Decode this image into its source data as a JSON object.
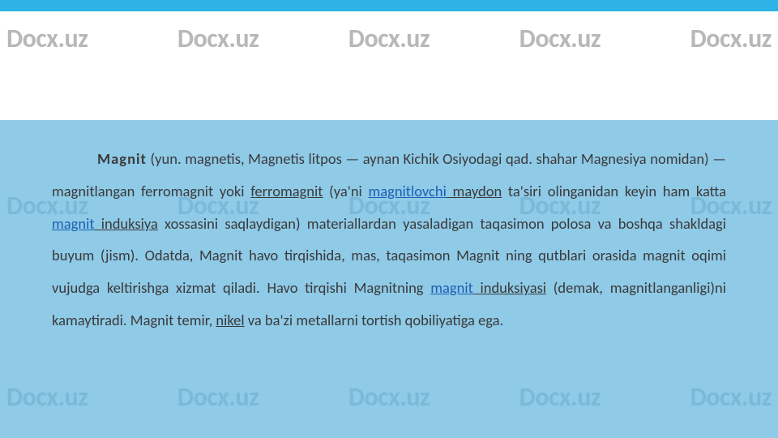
{
  "watermark": "Docx.uz",
  "body": {
    "lead": "Magnit",
    "t1": " (yun. magnetis, Magnetis litpos — aynan Kichik Osiyodagi qad. shahar Magnesiya nomidan) — magnitlangan ferromagnit yoki ",
    "u1": "ferromagnit",
    "t2": " (ya'ni ",
    "l1": "magnitlovchi",
    "u2": " maydon",
    "t3": " ta'siri olinganidan keyin ham katta ",
    "l2": "magnit",
    "u3": " induksiya",
    "t4": " xossasini saqlaydigan) materiallardan yasaladigan taqasimon polosa va boshqa shakldagi buyum (jism). Odatda, Magnit havo tirqishida, mas, taqasimon Magnit ning qutblari orasida magnit oqimi vujudga keltirishga xizmat qiladi. Havo tirqishi Magnitning ",
    "l3": "magnit",
    "u4": " induksiyasi",
    "t5": " (demak, magnitlanganligi)ni kamaytiradi. Magnit temir, ",
    "u5": "nikel",
    "t6": " va ba'zi metallarni tortish qobiliyatiga ega."
  }
}
